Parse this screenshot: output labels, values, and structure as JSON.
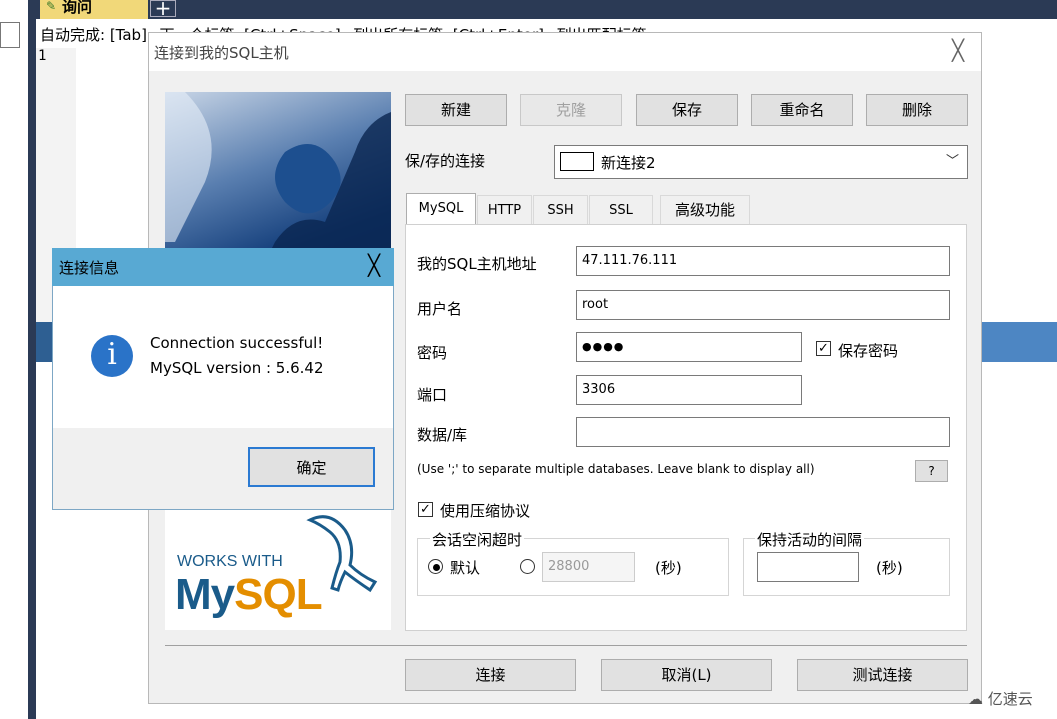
{
  "background": {
    "query_tab": "询问",
    "plus": "+",
    "autocomplete_line": "自动完成: [Tab]=下一个标签, [Ctrl+Space]=列出所有标签, [Ctrl+Enter]=列出匹配标签",
    "line_number": "1"
  },
  "dialog": {
    "title": "连接到我的SQL主机",
    "close": "╳",
    "toolbar": {
      "new": "新建",
      "clone": "克隆",
      "save": "保存",
      "rename": "重命名",
      "delete": "删除"
    },
    "saved_label": "保/存的连接",
    "saved_value": "新连接2",
    "tabs": [
      "MySQL",
      "HTTP",
      "SSH",
      "SSL",
      "高级功能"
    ],
    "fields": {
      "host_label": "我的SQL主机地址",
      "host_value": "47.111.76.111",
      "user_label": "用户名",
      "user_value": "root",
      "password_label": "密码",
      "password_value": "●●●●",
      "save_password_label": "保存密码",
      "port_label": "端口",
      "port_value": "3306",
      "database_label": "数据/库",
      "database_value": ""
    },
    "hint": "(Use ';' to separate multiple databases. Leave blank to display all)",
    "help": "?",
    "compression_label": "使用压缩协议",
    "session_group": "会话空闲超时",
    "default_label": "默认",
    "timeout_value": "28800",
    "sec1": "(秒)",
    "keepalive_group": "保持活动的间隔",
    "sec2": "(秒)",
    "footer": {
      "connect": "连接",
      "cancel": "取消(L)",
      "test": "测试连接"
    },
    "logo": {
      "works_with": "WORKS WITH",
      "mysql": "MySQL"
    }
  },
  "info_dialog": {
    "title": "连接信息",
    "close": "╳",
    "line1": "Connection successful!",
    "line2": "MySQL version : 5.6.42",
    "ok": "确定"
  },
  "watermark": "亿速云"
}
